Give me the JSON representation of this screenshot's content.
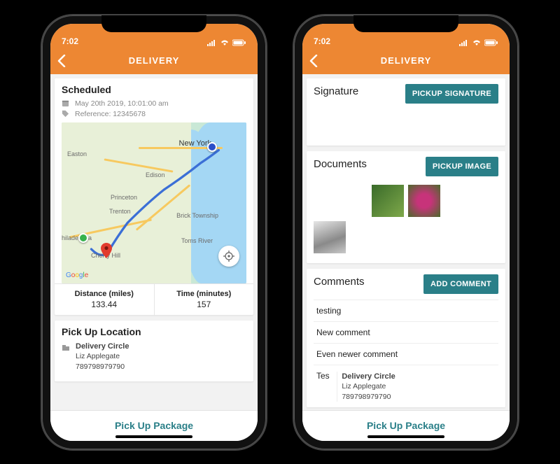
{
  "status": {
    "time": "7:02"
  },
  "nav": {
    "title": "DELIVERY"
  },
  "scheduled": {
    "heading": "Scheduled",
    "datetime": "May 20th 2019, 10:01:00 am",
    "reference": "Reference: 12345678"
  },
  "map": {
    "places": {
      "newyork": "New York",
      "easton": "Easton",
      "edison": "Edison",
      "princeton": "Princeton",
      "trenton": "Trenton",
      "philadelphia": "Philadelphia",
      "cherryhill": "Cherry Hill",
      "brick": "Brick Township",
      "tomsriver": "Toms River"
    },
    "attrib": "Google"
  },
  "stats": {
    "distance_label": "Distance (miles)",
    "distance_value": "133.44",
    "time_label": "Time (minutes)",
    "time_value": "157"
  },
  "pickup": {
    "heading": "Pick Up Location",
    "business": "Delivery Circle",
    "contact": "Liz Applegate",
    "tracking": "789798979790"
  },
  "signature": {
    "heading": "Signature",
    "button": "PICKUP SIGNATURE"
  },
  "documents": {
    "heading": "Documents",
    "button": "PICKUP IMAGE"
  },
  "comments": {
    "heading": "Comments",
    "button": "ADD COMMENT",
    "items": [
      "testing",
      "New comment",
      "Even newer comment",
      "Tes"
    ]
  },
  "footer": {
    "cta": "Pick Up Package"
  }
}
